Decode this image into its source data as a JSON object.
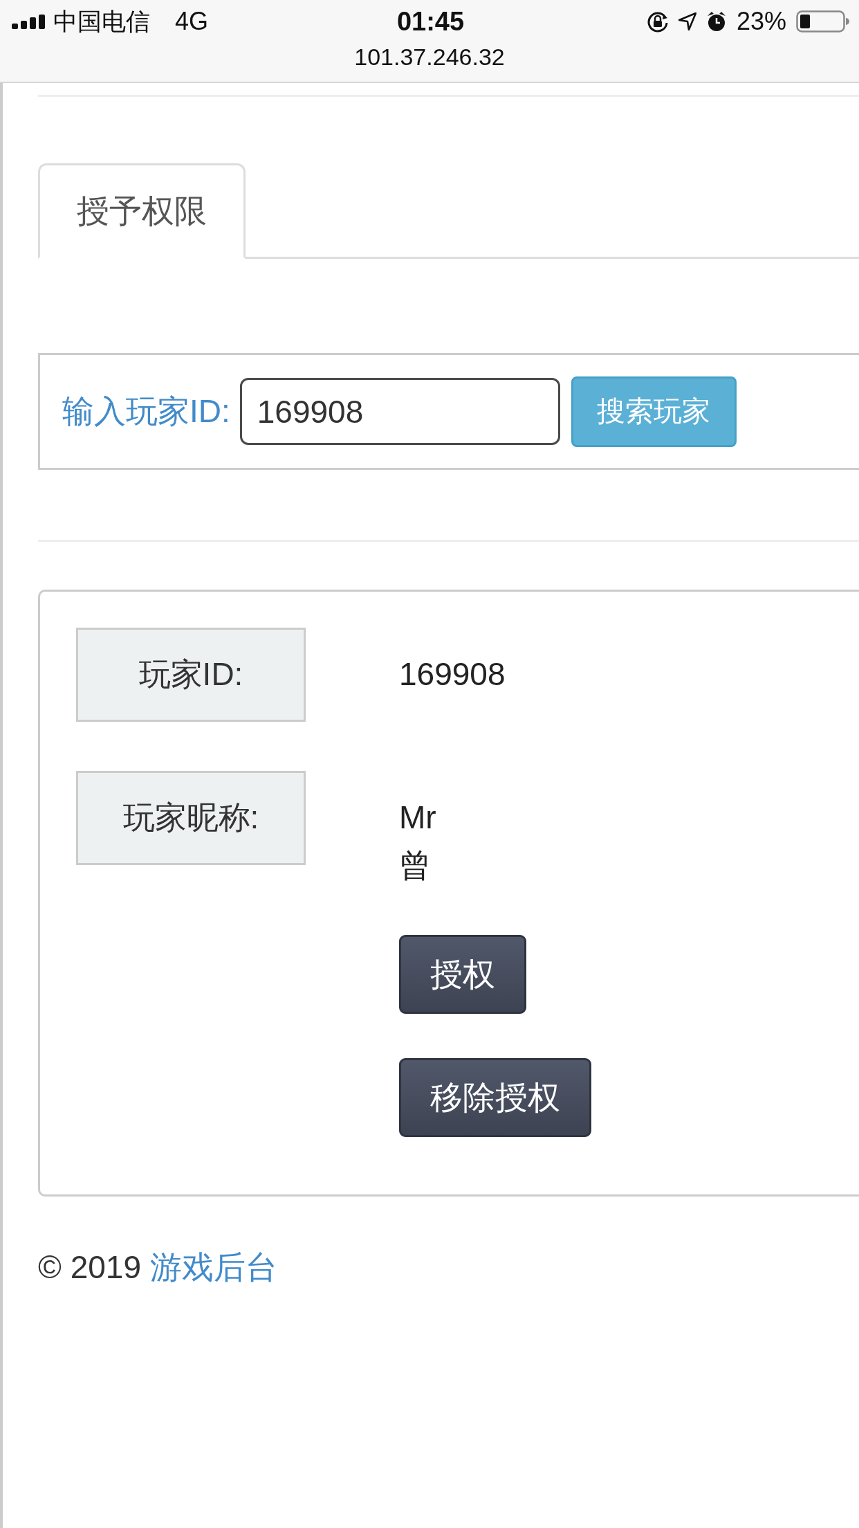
{
  "status_bar": {
    "carrier": "中国电信",
    "network": "4G",
    "time": "01:45",
    "battery": "23%",
    "url": "101.37.246.32"
  },
  "tabs": [
    {
      "label": "授予权限",
      "selected": true
    }
  ],
  "search": {
    "label": "输入玩家ID:",
    "value": "169908",
    "button": "搜索玩家"
  },
  "player": {
    "fields": [
      {
        "label": "玩家ID:",
        "value": "169908"
      },
      {
        "label": "玩家昵称:",
        "value": "Mr 曾"
      }
    ],
    "buttons": [
      "授权",
      "移除授权"
    ]
  },
  "footer": {
    "copyright": "© 2019",
    "link": "游戏后台"
  }
}
